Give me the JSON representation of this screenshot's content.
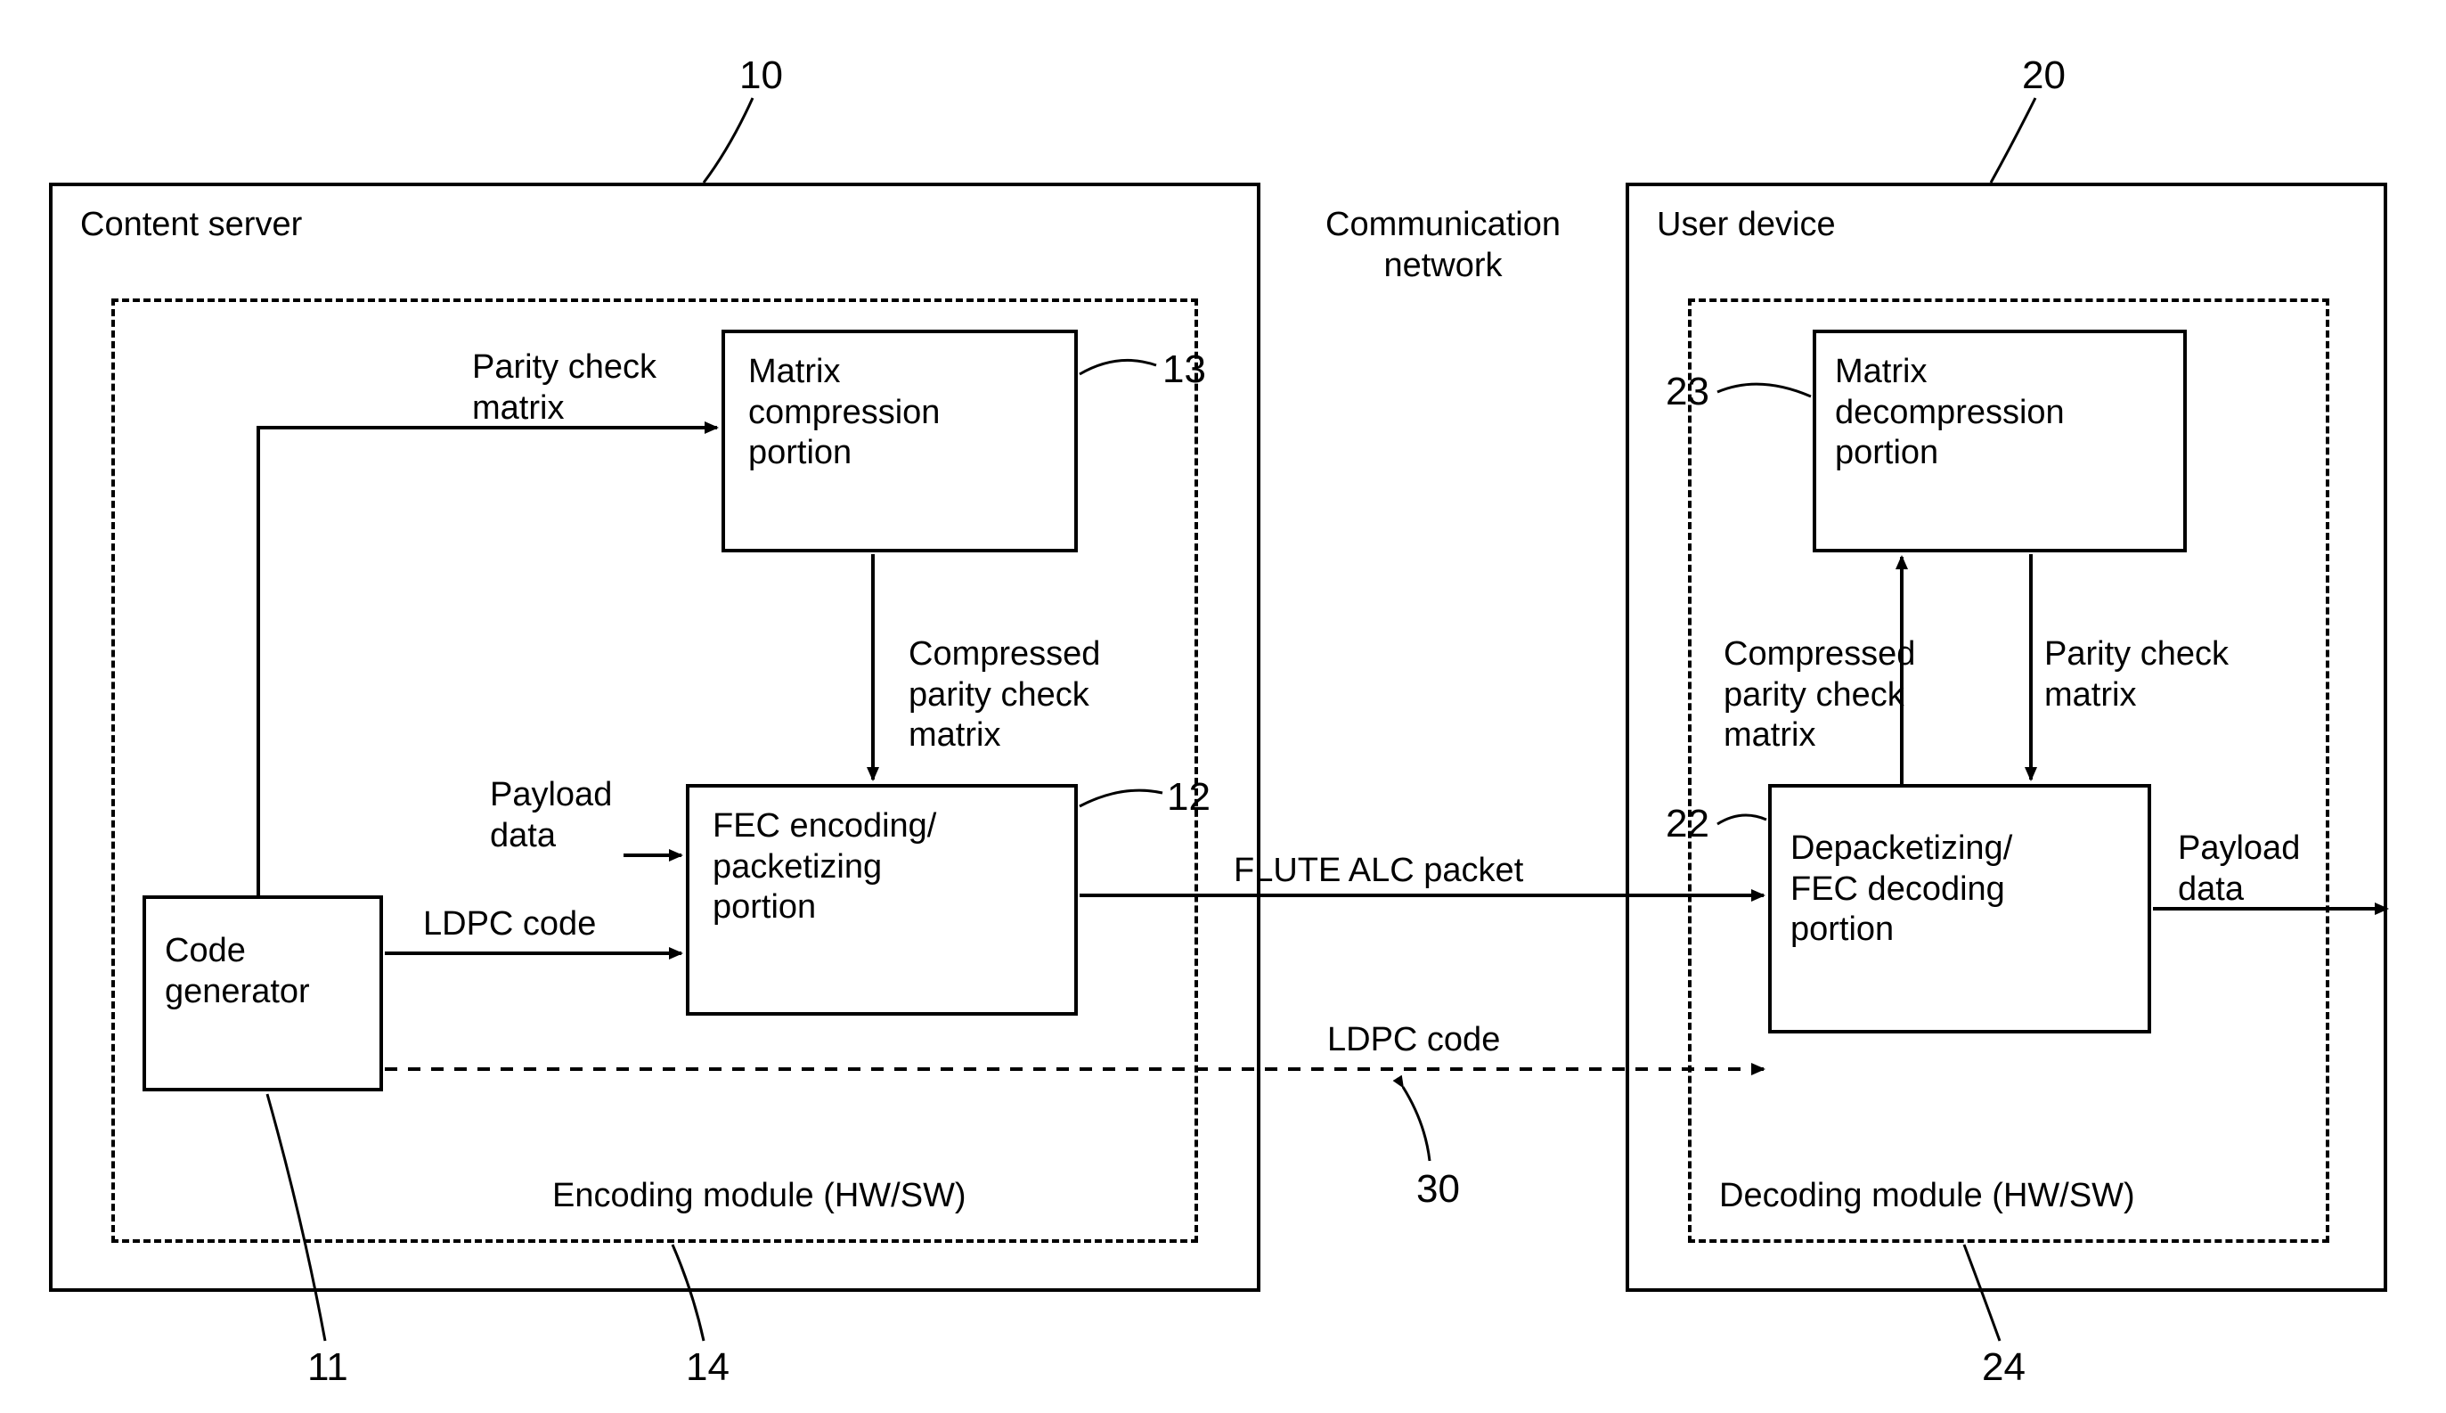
{
  "refs": {
    "r10": "10",
    "r20": "20",
    "r13": "13",
    "r23": "23",
    "r12": "12",
    "r22": "22",
    "r11": "11",
    "r14": "14",
    "r24": "24",
    "r30": "30"
  },
  "titles": {
    "content_server": "Content server",
    "comm_network": "Communication\nnetwork",
    "user_device": "User device",
    "encoding_module": "Encoding module (HW/SW)",
    "decoding_module": "Decoding module (HW/SW)"
  },
  "blocks": {
    "code_generator": "Code\ngenerator",
    "matrix_compression": "Matrix\ncompression\nportion",
    "fec_encoding": "FEC encoding/\npacketizing\nportion",
    "matrix_decompression": "Matrix\ndecompression\nportion",
    "depacketizing": "Depacketizing/\nFEC decoding\nportion"
  },
  "signals": {
    "parity_check_matrix": "Parity check\nmatrix",
    "compressed_parity_check_matrix": "Compressed\nparity check\nmatrix",
    "payload_data": "Payload\ndata",
    "payload_data_out": "Payload\ndata",
    "ldpc_code": "LDPC code",
    "flute_alc_packet": "FLUTE ALC packet",
    "ldpc_code2": "LDPC code",
    "parity_check_matrix_r": "Parity check\nmatrix",
    "compressed_parity_check_matrix_r": "Compressed\nparity check\nmatrix"
  }
}
